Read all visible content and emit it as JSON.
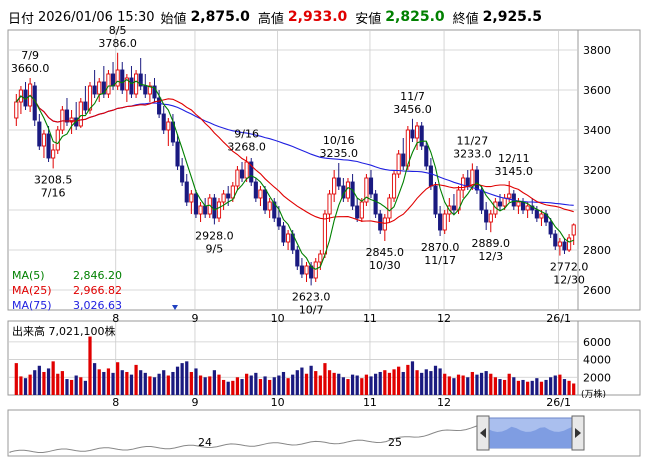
{
  "header": {
    "date_label": "日付",
    "datetime": "2026/01/06 15:30",
    "open_label": "始値",
    "open": "2,875.0",
    "high_label": "高値",
    "high": "2,933.0",
    "low_label": "安値",
    "low": "2,825.0",
    "close_label": "終値",
    "close": "2,925.5"
  },
  "legend": [
    {
      "label": "MA(5)",
      "value": "2,846.20",
      "color": "#008000"
    },
    {
      "label": "MA(25)",
      "value": "2,966.82",
      "color": "#e00000"
    },
    {
      "label": "MA(75)",
      "value": "3,026.63",
      "color": "#2020e0"
    }
  ],
  "volume_title": "出来高  7,021,100株",
  "volume_unit": "(万株)",
  "navigator_labels": [
    "24",
    "25"
  ],
  "colors": {
    "up": "#e00000",
    "down": "#1a1a80",
    "ma5": "#008000",
    "ma25": "#e00000",
    "ma75": "#2020e0",
    "grid": "#cccccc"
  },
  "chart_data": {
    "type": "candlestick",
    "y_range": [
      2500,
      3900
    ],
    "y_ticks": [
      2600,
      2800,
      3000,
      3200,
      3400,
      3600,
      3800
    ],
    "volume_range": [
      0,
      7000
    ],
    "volume_ticks": [
      2000,
      4000,
      6000
    ],
    "x_month_labels": [
      {
        "label": "8",
        "pos": 0.189
      },
      {
        "label": "9",
        "pos": 0.328
      },
      {
        "label": "10",
        "pos": 0.473
      },
      {
        "label": "11",
        "pos": 0.635
      },
      {
        "label": "12",
        "pos": 0.765
      },
      {
        "label": "26/1",
        "pos": 0.966
      }
    ],
    "annotations": [
      {
        "date": "7/9",
        "value": "3660.0",
        "kind": "high",
        "idx": 3,
        "price": 3660
      },
      {
        "date": "8/5",
        "value": "3786.0",
        "kind": "high",
        "idx": 22,
        "price": 3786
      },
      {
        "date": "7/16",
        "value": "3208.5",
        "kind": "low",
        "idx": 8,
        "price": 3208.5
      },
      {
        "date": "9/16",
        "value": "3268.0",
        "kind": "high",
        "idx": 50,
        "price": 3268
      },
      {
        "date": "9/5",
        "value": "2928.0",
        "kind": "low",
        "idx": 43,
        "price": 2928
      },
      {
        "date": "10/16",
        "value": "3235.0",
        "kind": "high",
        "idx": 70,
        "price": 3235
      },
      {
        "date": "10/7",
        "value": "2623.0",
        "kind": "low",
        "idx": 64,
        "price": 2623
      },
      {
        "date": "11/7",
        "value": "3456.0",
        "kind": "high",
        "idx": 86,
        "price": 3456
      },
      {
        "date": "10/30",
        "value": "2845.0",
        "kind": "low",
        "idx": 80,
        "price": 2845
      },
      {
        "date": "11/17",
        "value": "2870.0",
        "kind": "low",
        "idx": 92,
        "price": 2870
      },
      {
        "date": "11/27",
        "value": "3233.0",
        "kind": "high",
        "idx": 99,
        "price": 3233
      },
      {
        "date": "12/3",
        "value": "2889.0",
        "kind": "low",
        "idx": 103,
        "price": 2889
      },
      {
        "date": "12/11",
        "value": "3145.0",
        "kind": "high",
        "idx": 108,
        "price": 3145
      },
      {
        "date": "12/30",
        "value": "2772.0",
        "kind": "low",
        "idx": 120,
        "price": 2772
      }
    ],
    "candles": [
      {
        "o": 3460,
        "h": 3580,
        "l": 3420,
        "c": 3540,
        "v": 3600
      },
      {
        "o": 3540,
        "h": 3620,
        "l": 3480,
        "c": 3600,
        "v": 2100
      },
      {
        "o": 3600,
        "h": 3640,
        "l": 3500,
        "c": 3520,
        "v": 1900
      },
      {
        "o": 3520,
        "h": 3660,
        "l": 3490,
        "c": 3630,
        "v": 2300
      },
      {
        "o": 3620,
        "h": 3640,
        "l": 3420,
        "c": 3450,
        "v": 2800
      },
      {
        "o": 3440,
        "h": 3480,
        "l": 3300,
        "c": 3320,
        "v": 3300
      },
      {
        "o": 3320,
        "h": 3400,
        "l": 3260,
        "c": 3380,
        "v": 2600
      },
      {
        "o": 3380,
        "h": 3420,
        "l": 3240,
        "c": 3260,
        "v": 3000
      },
      {
        "o": 3260,
        "h": 3330,
        "l": 3208,
        "c": 3300,
        "v": 3800
      },
      {
        "o": 3300,
        "h": 3420,
        "l": 3280,
        "c": 3400,
        "v": 2400
      },
      {
        "o": 3400,
        "h": 3520,
        "l": 3380,
        "c": 3500,
        "v": 2700
      },
      {
        "o": 3500,
        "h": 3560,
        "l": 3420,
        "c": 3440,
        "v": 1800
      },
      {
        "o": 3440,
        "h": 3500,
        "l": 3380,
        "c": 3460,
        "v": 1700
      },
      {
        "o": 3460,
        "h": 3540,
        "l": 3400,
        "c": 3420,
        "v": 2200
      },
      {
        "o": 3420,
        "h": 3560,
        "l": 3410,
        "c": 3540,
        "v": 2000
      },
      {
        "o": 3540,
        "h": 3620,
        "l": 3480,
        "c": 3500,
        "v": 1600
      },
      {
        "o": 3500,
        "h": 3640,
        "l": 3480,
        "c": 3620,
        "v": 6600
      },
      {
        "o": 3620,
        "h": 3700,
        "l": 3560,
        "c": 3580,
        "v": 3600
      },
      {
        "o": 3580,
        "h": 3660,
        "l": 3540,
        "c": 3640,
        "v": 2900
      },
      {
        "o": 3640,
        "h": 3720,
        "l": 3560,
        "c": 3580,
        "v": 2600
      },
      {
        "o": 3580,
        "h": 3700,
        "l": 3560,
        "c": 3680,
        "v": 3000
      },
      {
        "o": 3680,
        "h": 3740,
        "l": 3600,
        "c": 3620,
        "v": 2500
      },
      {
        "o": 3620,
        "h": 3786,
        "l": 3600,
        "c": 3700,
        "v": 3700
      },
      {
        "o": 3700,
        "h": 3740,
        "l": 3580,
        "c": 3600,
        "v": 2800
      },
      {
        "o": 3600,
        "h": 3680,
        "l": 3540,
        "c": 3660,
        "v": 2600
      },
      {
        "o": 3660,
        "h": 3720,
        "l": 3560,
        "c": 3580,
        "v": 2300
      },
      {
        "o": 3580,
        "h": 3700,
        "l": 3560,
        "c": 3680,
        "v": 3400
      },
      {
        "o": 3680,
        "h": 3760,
        "l": 3600,
        "c": 3620,
        "v": 2800
      },
      {
        "o": 3620,
        "h": 3680,
        "l": 3560,
        "c": 3580,
        "v": 2500
      },
      {
        "o": 3580,
        "h": 3640,
        "l": 3540,
        "c": 3620,
        "v": 2100
      },
      {
        "o": 3620,
        "h": 3660,
        "l": 3540,
        "c": 3560,
        "v": 2000
      },
      {
        "o": 3560,
        "h": 3600,
        "l": 3460,
        "c": 3480,
        "v": 2400
      },
      {
        "o": 3480,
        "h": 3520,
        "l": 3380,
        "c": 3400,
        "v": 2800
      },
      {
        "o": 3400,
        "h": 3460,
        "l": 3320,
        "c": 3440,
        "v": 2200
      },
      {
        "o": 3440,
        "h": 3480,
        "l": 3320,
        "c": 3340,
        "v": 2600
      },
      {
        "o": 3340,
        "h": 3380,
        "l": 3200,
        "c": 3220,
        "v": 3200
      },
      {
        "o": 3220,
        "h": 3260,
        "l": 3120,
        "c": 3140,
        "v": 3600
      },
      {
        "o": 3140,
        "h": 3180,
        "l": 3020,
        "c": 3040,
        "v": 3800
      },
      {
        "o": 3040,
        "h": 3100,
        "l": 2980,
        "c": 3080,
        "v": 2600
      },
      {
        "o": 3080,
        "h": 3100,
        "l": 2960,
        "c": 2980,
        "v": 3000
      },
      {
        "o": 2980,
        "h": 3040,
        "l": 2940,
        "c": 3020,
        "v": 2200
      },
      {
        "o": 3020,
        "h": 3060,
        "l": 2960,
        "c": 2980,
        "v": 2000
      },
      {
        "o": 2980,
        "h": 3080,
        "l": 2960,
        "c": 3060,
        "v": 2100
      },
      {
        "o": 3060,
        "h": 3080,
        "l": 2928,
        "c": 2960,
        "v": 2800
      },
      {
        "o": 2960,
        "h": 3060,
        "l": 2940,
        "c": 3040,
        "v": 2300
      },
      {
        "o": 3040,
        "h": 3100,
        "l": 3000,
        "c": 3080,
        "v": 1700
      },
      {
        "o": 3080,
        "h": 3120,
        "l": 3020,
        "c": 3060,
        "v": 1500
      },
      {
        "o": 3060,
        "h": 3140,
        "l": 3040,
        "c": 3120,
        "v": 1600
      },
      {
        "o": 3120,
        "h": 3220,
        "l": 3100,
        "c": 3200,
        "v": 2000
      },
      {
        "o": 3200,
        "h": 3240,
        "l": 3140,
        "c": 3160,
        "v": 1800
      },
      {
        "o": 3160,
        "h": 3268,
        "l": 3140,
        "c": 3240,
        "v": 2400
      },
      {
        "o": 3240,
        "h": 3260,
        "l": 3120,
        "c": 3140,
        "v": 2200
      },
      {
        "o": 3140,
        "h": 3160,
        "l": 3040,
        "c": 3060,
        "v": 2500
      },
      {
        "o": 3060,
        "h": 3120,
        "l": 3020,
        "c": 3100,
        "v": 1800
      },
      {
        "o": 3100,
        "h": 3120,
        "l": 2980,
        "c": 3000,
        "v": 2100
      },
      {
        "o": 3000,
        "h": 3060,
        "l": 2960,
        "c": 3040,
        "v": 1700
      },
      {
        "o": 3040,
        "h": 3060,
        "l": 2940,
        "c": 2960,
        "v": 2000
      },
      {
        "o": 2960,
        "h": 3020,
        "l": 2900,
        "c": 2920,
        "v": 2200
      },
      {
        "o": 2920,
        "h": 2940,
        "l": 2820,
        "c": 2840,
        "v": 2600
      },
      {
        "o": 2840,
        "h": 2900,
        "l": 2800,
        "c": 2880,
        "v": 1900
      },
      {
        "o": 2880,
        "h": 2900,
        "l": 2780,
        "c": 2800,
        "v": 2300
      },
      {
        "o": 2800,
        "h": 2820,
        "l": 2700,
        "c": 2720,
        "v": 2800
      },
      {
        "o": 2720,
        "h": 2760,
        "l": 2660,
        "c": 2680,
        "v": 3100
      },
      {
        "o": 2680,
        "h": 2740,
        "l": 2640,
        "c": 2720,
        "v": 2400
      },
      {
        "o": 2720,
        "h": 2740,
        "l": 2623,
        "c": 2660,
        "v": 3300
      },
      {
        "o": 2660,
        "h": 2760,
        "l": 2640,
        "c": 2740,
        "v": 2700
      },
      {
        "o": 2740,
        "h": 2800,
        "l": 2700,
        "c": 2780,
        "v": 2200
      },
      {
        "o": 2780,
        "h": 3000,
        "l": 2760,
        "c": 2980,
        "v": 3600
      },
      {
        "o": 2980,
        "h": 3100,
        "l": 2940,
        "c": 3080,
        "v": 2800
      },
      {
        "o": 3080,
        "h": 3200,
        "l": 3040,
        "c": 3160,
        "v": 2500
      },
      {
        "o": 3160,
        "h": 3235,
        "l": 3100,
        "c": 3120,
        "v": 2400
      },
      {
        "o": 3120,
        "h": 3160,
        "l": 3040,
        "c": 3060,
        "v": 2000
      },
      {
        "o": 3060,
        "h": 3160,
        "l": 3040,
        "c": 3140,
        "v": 1800
      },
      {
        "o": 3140,
        "h": 3180,
        "l": 3000,
        "c": 3020,
        "v": 2300
      },
      {
        "o": 3020,
        "h": 3060,
        "l": 2940,
        "c": 2960,
        "v": 2200
      },
      {
        "o": 2960,
        "h": 3060,
        "l": 2940,
        "c": 3040,
        "v": 1900
      },
      {
        "o": 3040,
        "h": 3180,
        "l": 3020,
        "c": 3160,
        "v": 2300
      },
      {
        "o": 3160,
        "h": 3200,
        "l": 3060,
        "c": 3080,
        "v": 2100
      },
      {
        "o": 3080,
        "h": 3100,
        "l": 2960,
        "c": 2980,
        "v": 2400
      },
      {
        "o": 2980,
        "h": 3000,
        "l": 2880,
        "c": 2900,
        "v": 2600
      },
      {
        "o": 2900,
        "h": 2980,
        "l": 2845,
        "c": 2960,
        "v": 2800
      },
      {
        "o": 2960,
        "h": 3080,
        "l": 2940,
        "c": 3060,
        "v": 2500
      },
      {
        "o": 3060,
        "h": 3200,
        "l": 3040,
        "c": 3180,
        "v": 2900
      },
      {
        "o": 3180,
        "h": 3300,
        "l": 3160,
        "c": 3280,
        "v": 3200
      },
      {
        "o": 3280,
        "h": 3360,
        "l": 3200,
        "c": 3220,
        "v": 2600
      },
      {
        "o": 3220,
        "h": 3420,
        "l": 3200,
        "c": 3400,
        "v": 3400
      },
      {
        "o": 3400,
        "h": 3456,
        "l": 3340,
        "c": 3360,
        "v": 3800
      },
      {
        "o": 3360,
        "h": 3440,
        "l": 3300,
        "c": 3420,
        "v": 2800
      },
      {
        "o": 3420,
        "h": 3440,
        "l": 3300,
        "c": 3320,
        "v": 2500
      },
      {
        "o": 3320,
        "h": 3340,
        "l": 3200,
        "c": 3220,
        "v": 2900
      },
      {
        "o": 3220,
        "h": 3260,
        "l": 3100,
        "c": 3120,
        "v": 2700
      },
      {
        "o": 3120,
        "h": 3140,
        "l": 2960,
        "c": 2980,
        "v": 3300
      },
      {
        "o": 2980,
        "h": 3020,
        "l": 2870,
        "c": 2900,
        "v": 3000
      },
      {
        "o": 2900,
        "h": 3000,
        "l": 2880,
        "c": 2980,
        "v": 2400
      },
      {
        "o": 2980,
        "h": 3060,
        "l": 2940,
        "c": 3020,
        "v": 2100
      },
      {
        "o": 3020,
        "h": 3080,
        "l": 2980,
        "c": 3000,
        "v": 1900
      },
      {
        "o": 3000,
        "h": 3120,
        "l": 2980,
        "c": 3100,
        "v": 2300
      },
      {
        "o": 3100,
        "h": 3180,
        "l": 3060,
        "c": 3160,
        "v": 2200
      },
      {
        "o": 3160,
        "h": 3200,
        "l": 3100,
        "c": 3120,
        "v": 2000
      },
      {
        "o": 3120,
        "h": 3233,
        "l": 3100,
        "c": 3200,
        "v": 2600
      },
      {
        "o": 3200,
        "h": 3220,
        "l": 3080,
        "c": 3100,
        "v": 2300
      },
      {
        "o": 3100,
        "h": 3120,
        "l": 2980,
        "c": 3000,
        "v": 2500
      },
      {
        "o": 3000,
        "h": 3040,
        "l": 2900,
        "c": 2940,
        "v": 2700
      },
      {
        "o": 2940,
        "h": 3000,
        "l": 2889,
        "c": 2980,
        "v": 2400
      },
      {
        "o": 2980,
        "h": 3060,
        "l": 2960,
        "c": 3040,
        "v": 2000
      },
      {
        "o": 3040,
        "h": 3080,
        "l": 3000,
        "c": 3020,
        "v": 1800
      },
      {
        "o": 3020,
        "h": 3080,
        "l": 3000,
        "c": 3060,
        "v": 1700
      },
      {
        "o": 3060,
        "h": 3145,
        "l": 3040,
        "c": 3080,
        "v": 2400
      },
      {
        "o": 3080,
        "h": 3100,
        "l": 3000,
        "c": 3020,
        "v": 2000
      },
      {
        "o": 3020,
        "h": 3060,
        "l": 2980,
        "c": 3040,
        "v": 1600
      },
      {
        "o": 3040,
        "h": 3060,
        "l": 2980,
        "c": 3000,
        "v": 1700
      },
      {
        "o": 3000,
        "h": 3040,
        "l": 2960,
        "c": 3020,
        "v": 1500
      },
      {
        "o": 3020,
        "h": 3060,
        "l": 2980,
        "c": 3000,
        "v": 1600
      },
      {
        "o": 3000,
        "h": 3020,
        "l": 2940,
        "c": 2960,
        "v": 1900
      },
      {
        "o": 2960,
        "h": 3000,
        "l": 2920,
        "c": 2980,
        "v": 1500
      },
      {
        "o": 2980,
        "h": 3000,
        "l": 2920,
        "c": 2940,
        "v": 1700
      },
      {
        "o": 2940,
        "h": 2960,
        "l": 2860,
        "c": 2880,
        "v": 2000
      },
      {
        "o": 2880,
        "h": 2900,
        "l": 2800,
        "c": 2820,
        "v": 2200
      },
      {
        "o": 2820,
        "h": 2860,
        "l": 2772,
        "c": 2840,
        "v": 2300
      },
      {
        "o": 2840,
        "h": 2860,
        "l": 2780,
        "c": 2800,
        "v": 1800
      },
      {
        "o": 2800,
        "h": 2880,
        "l": 2790,
        "c": 2860,
        "v": 1600
      },
      {
        "o": 2875,
        "h": 2933,
        "l": 2825,
        "c": 2925.5,
        "v": 1300
      }
    ]
  }
}
